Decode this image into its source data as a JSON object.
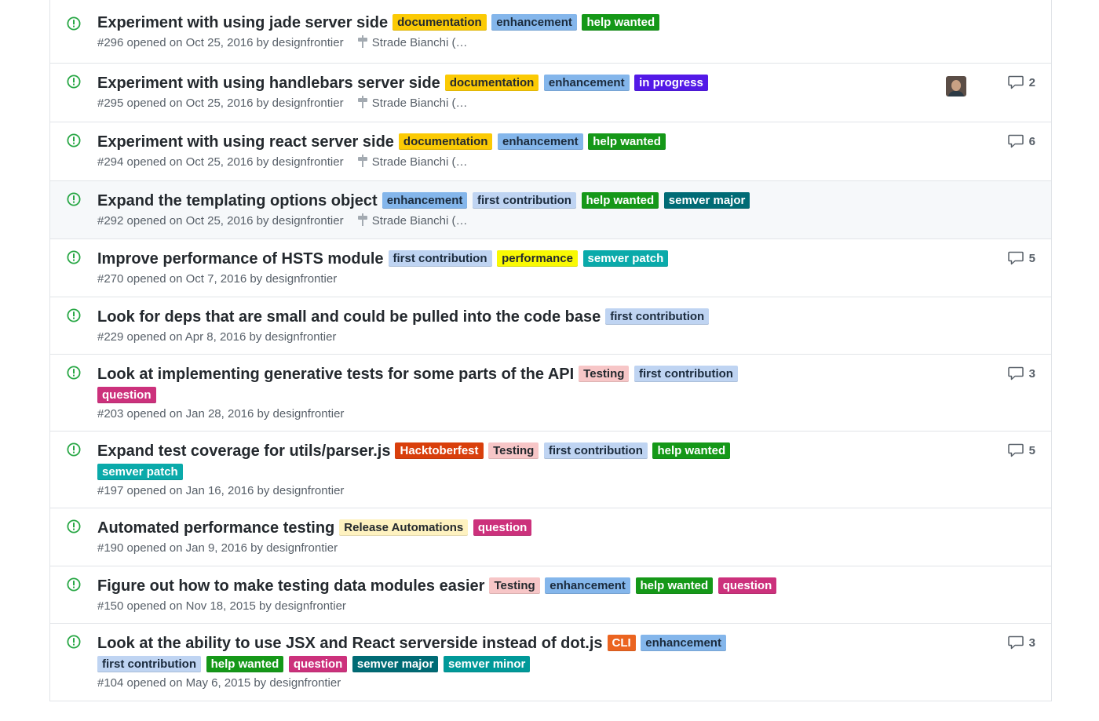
{
  "issues": [
    {
      "title": "Experiment with using jade server side",
      "labels": [
        "documentation",
        "enhancement",
        "help wanted"
      ],
      "meta": "#296 opened on Oct 25, 2016 by designfrontier",
      "milestone": "Strade Bianchi (…",
      "comments": ""
    },
    {
      "title": "Experiment with using handlebars server side",
      "labels": [
        "documentation",
        "enhancement",
        "in progress"
      ],
      "meta": "#295 opened on Oct 25, 2016 by designfrontier",
      "milestone": "Strade Bianchi (…",
      "comments": "2"
    },
    {
      "title": "Experiment with using react server side",
      "labels": [
        "documentation",
        "enhancement",
        "help wanted"
      ],
      "meta": "#294 opened on Oct 25, 2016 by designfrontier",
      "milestone": "Strade Bianchi (…",
      "comments": "6"
    },
    {
      "title": "Expand the templating options object",
      "labels": [
        "enhancement",
        "first contribution",
        "help wanted",
        "semver major"
      ],
      "meta": "#292 opened on Oct 25, 2016 by designfrontier",
      "milestone": "Strade Bianchi (…",
      "comments": ""
    },
    {
      "title": "Improve performance of HSTS module",
      "labels": [
        "first contribution",
        "performance",
        "semver patch"
      ],
      "meta": "#270 opened on Oct 7, 2016 by designfrontier",
      "milestone": "",
      "comments": "5"
    },
    {
      "title": "Look for deps that are small and could be pulled into the code base",
      "labels": [
        "first contribution"
      ],
      "meta": "#229 opened on Apr 8, 2016 by designfrontier",
      "milestone": "",
      "comments": ""
    },
    {
      "title": "Look at implementing generative tests for some parts of the API",
      "labels": [
        "Testing",
        "first contribution"
      ],
      "labels_line2": [
        "question"
      ],
      "meta": "#203 opened on Jan 28, 2016 by designfrontier",
      "milestone": "",
      "comments": "3"
    },
    {
      "title": "Expand test coverage for utils/parser.js",
      "labels": [
        "Hacktoberfest",
        "Testing",
        "first contribution",
        "help wanted"
      ],
      "labels_line2": [
        "semver patch"
      ],
      "meta": "#197 opened on Jan 16, 2016 by designfrontier",
      "milestone": "",
      "comments": "5"
    },
    {
      "title": "Automated performance testing",
      "labels": [
        "Release Automations",
        "question"
      ],
      "meta": "#190 opened on Jan 9, 2016 by designfrontier",
      "milestone": "",
      "comments": ""
    },
    {
      "title": "Figure out how to make testing data modules easier",
      "labels": [
        "Testing",
        "enhancement",
        "help wanted",
        "question"
      ],
      "meta": "#150 opened on Nov 18, 2015 by designfrontier",
      "milestone": "",
      "comments": ""
    },
    {
      "title": "Look at the ability to use JSX and React serverside instead of dot.js",
      "labels": [
        "CLI",
        "enhancement"
      ],
      "labels_line2": [
        "first contribution",
        "help wanted",
        "question",
        "semver major",
        "semver minor"
      ],
      "meta": "#104 opened on May 6, 2015 by designfrontier",
      "milestone": "",
      "comments": "3"
    }
  ],
  "icons": {
    "status": "issue-opened-icon",
    "milestone": "milestone-icon",
    "comment": "comment-icon"
  },
  "colors": {
    "open_issue_green": "#28a745",
    "border": "#e1e4e8",
    "meta_text": "#586069"
  }
}
